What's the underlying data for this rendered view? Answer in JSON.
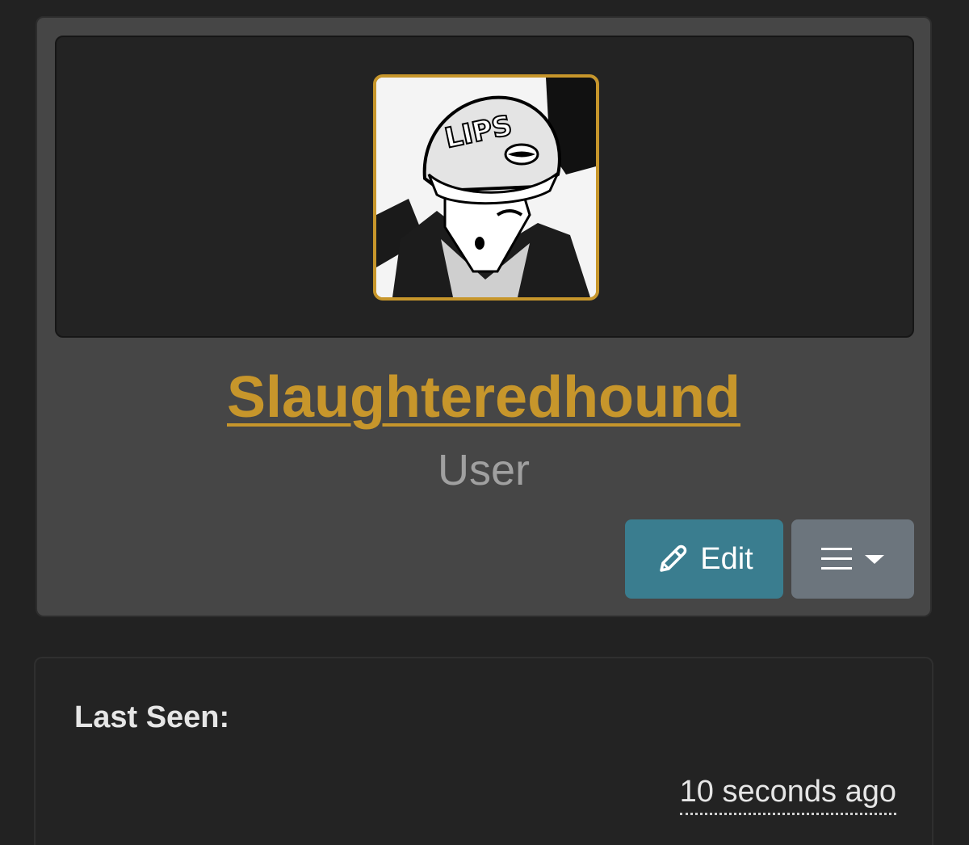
{
  "profile": {
    "username": "Slaughteredhound",
    "role": "User",
    "avatar_alt": "Slaughteredhound avatar",
    "avatar_border_color": "#c7962b"
  },
  "actions": {
    "edit_label": "Edit",
    "edit_icon": "pencil-icon",
    "menu_icon": "hamburger-icon",
    "menu_caret_icon": "caret-down-icon"
  },
  "info": {
    "last_seen_label": "Last Seen:",
    "last_seen_value": "10 seconds ago"
  },
  "colors": {
    "accent": "#c7962b",
    "edit_button": "#3a7d8f",
    "menu_button": "#6c757d",
    "card_bg": "#464646",
    "page_bg": "#222222"
  }
}
